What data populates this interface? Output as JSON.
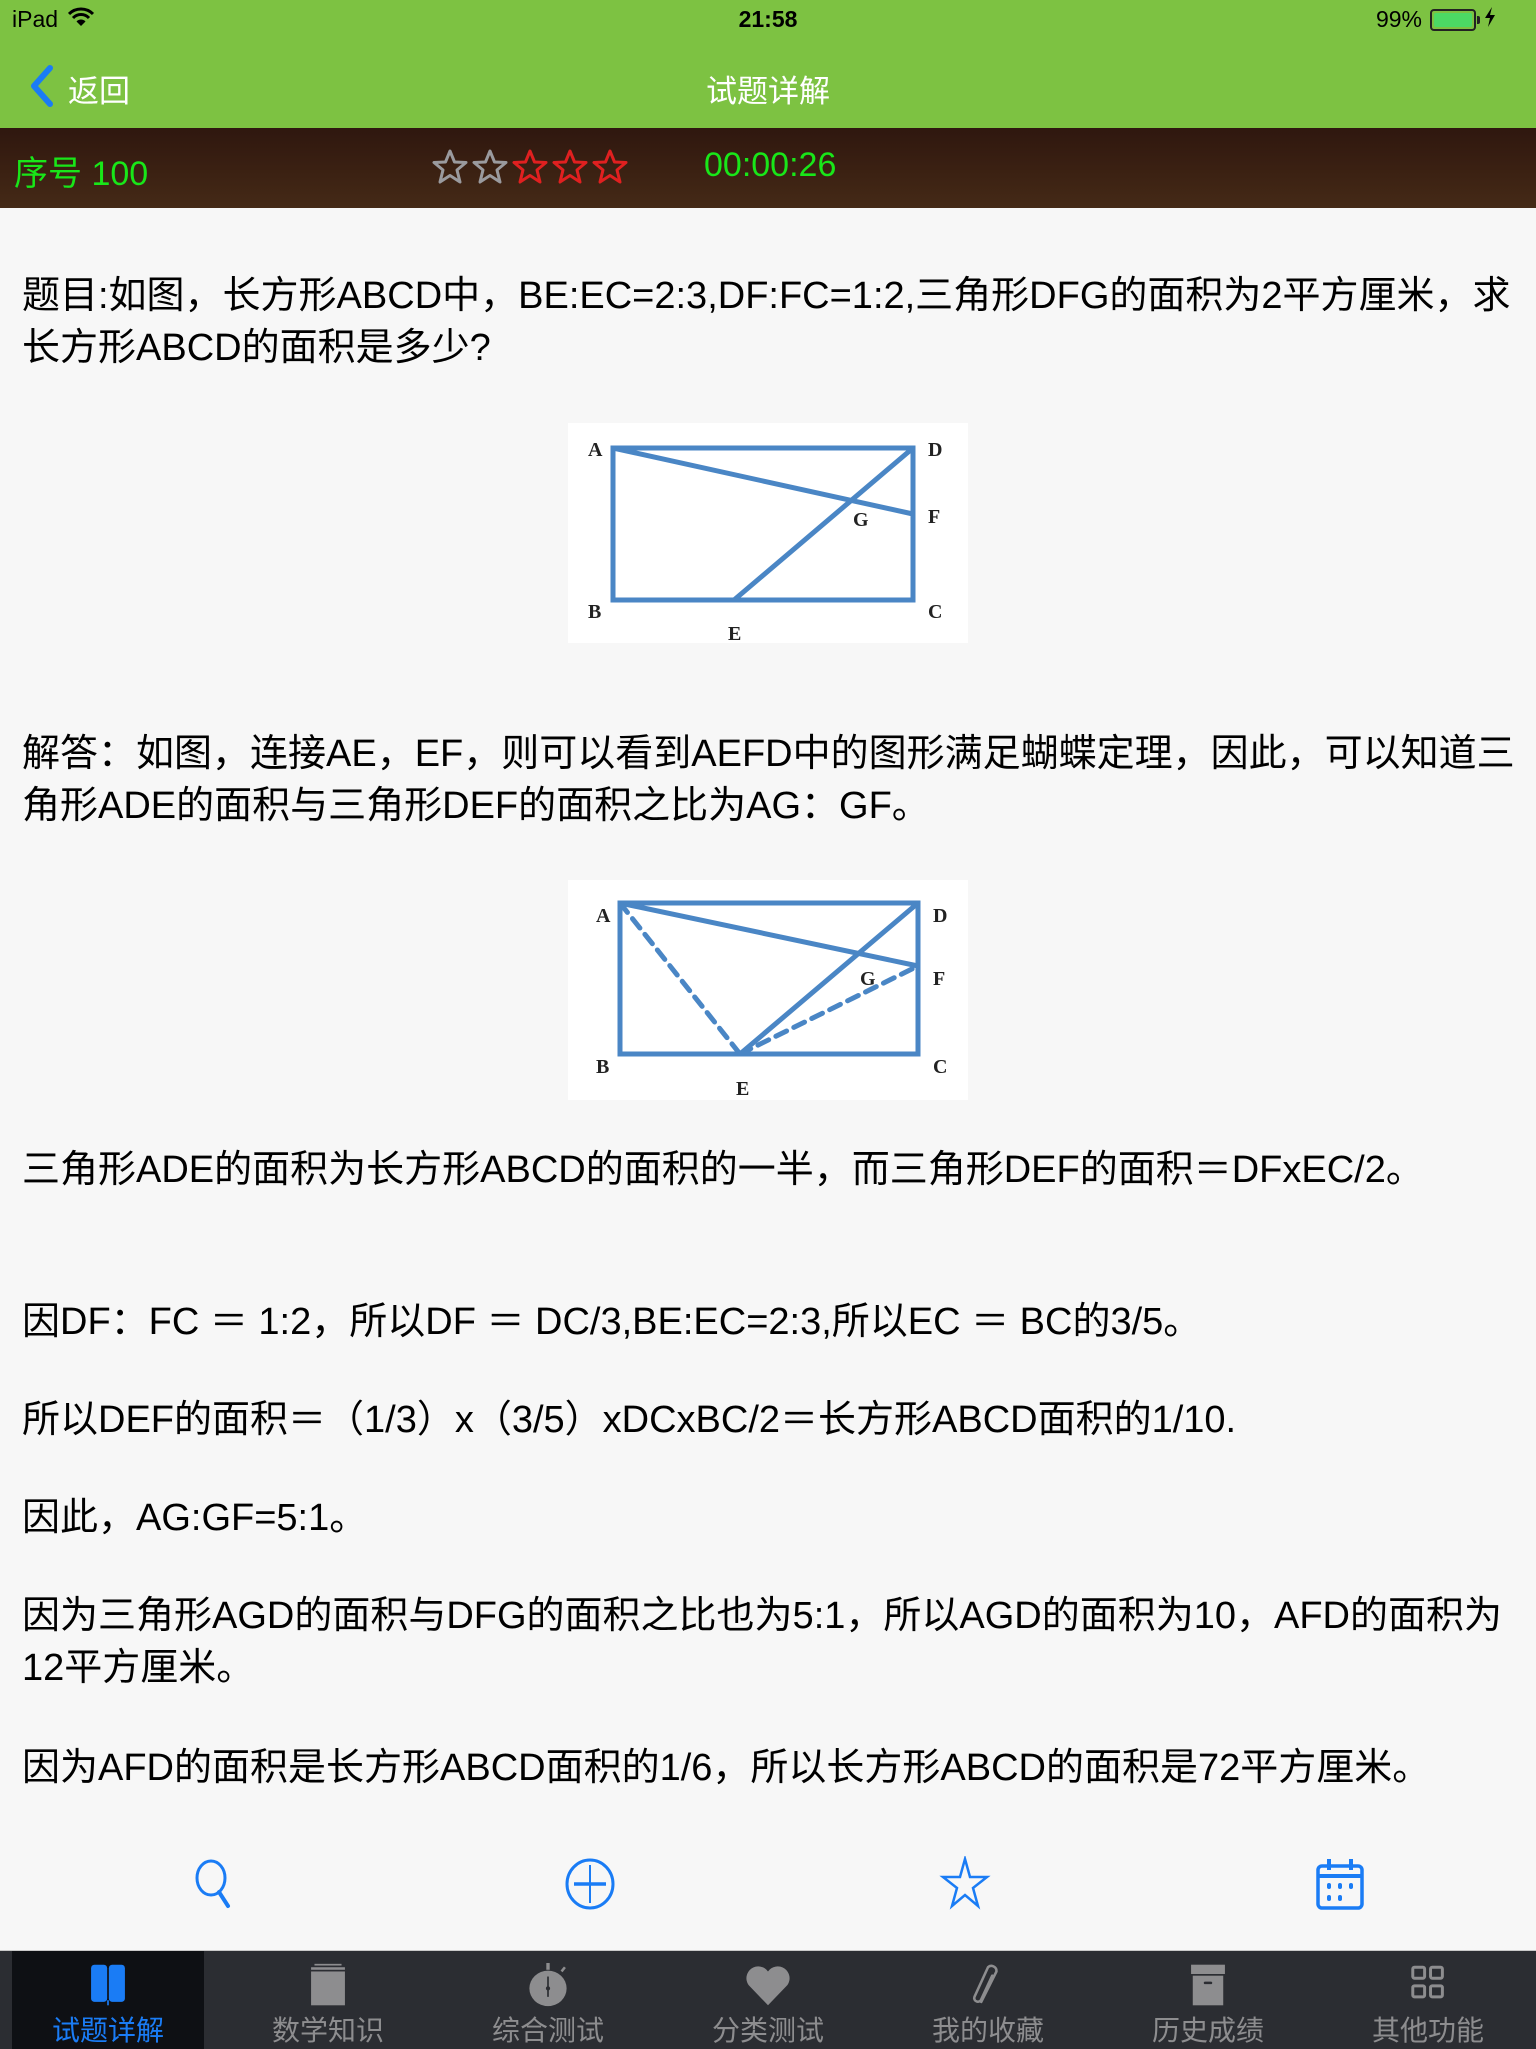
{
  "status_bar": {
    "device": "iPad",
    "time": "21:58",
    "battery_percent": "99%",
    "battery_level": 0.99
  },
  "nav": {
    "back_label": "返回",
    "title": "试题详解"
  },
  "info_bar": {
    "sequence_label": "序号 100",
    "difficulty_stars_total": 5,
    "difficulty_stars_filled": 3,
    "timer": "00:00:26",
    "colors": {
      "text": "#19e619",
      "star_active": "#e02020",
      "star_inactive": "#9a9a9e"
    }
  },
  "content": {
    "question": "题目:如图，长方形ABCD中，BE:EC=2:3,DF:FC=1:2,三角形DFG的面积为2平方厘米，求长方形ABCD的面积是多少?",
    "figure1": {
      "labels": {
        "A": "A",
        "B": "B",
        "C": "C",
        "D": "D",
        "E": "E",
        "F": "F",
        "G": "G"
      },
      "description": "Rectangle ABCD with segments AF and DE intersecting at G"
    },
    "answer_intro": "解答：如图，连接AE，EF，则可以看到AEFD中的图形满足蝴蝶定理，因此，可以知道三角形ADE的面积与三角形DEF的面积之比为AG：GF。",
    "figure2": {
      "labels": {
        "A": "A",
        "B": "B",
        "C": "C",
        "D": "D",
        "E": "E",
        "F": "F",
        "G": "G"
      },
      "description": "Same rectangle with dashed segments AE and EF added"
    },
    "paragraphs": [
      "三角形ADE的面积为长方形ABCD的面积的一半，而三角形DEF的面积＝DFxEC/2。",
      "因DF：FC ＝ 1:2，所以DF ＝ DC/3,BE:EC=2:3,所以EC ＝ BC的3/5。",
      "所以DEF的面积＝（1/3）x（3/5）xDCxBC/2＝长方形ABCD面积的1/10.",
      "因此，AG:GF=5:1。",
      "因为三角形AGD的面积与DFG的面积之比也为5:1，所以AGD的面积为10，AFD的面积为12平方厘米。",
      "因为AFD的面积是长方形ABCD面积的1/6，所以长方形ABCD的面积是72平方厘米。"
    ]
  },
  "toolbar": {
    "icons": [
      "search-icon",
      "add-circle-icon",
      "star-icon",
      "calendar-icon"
    ],
    "color": "#1a7cf5"
  },
  "tab_bar": {
    "selected_index": 0,
    "tabs": [
      {
        "label": "试题详解",
        "icon": "book-icon"
      },
      {
        "label": "数学知识",
        "icon": "stack-icon"
      },
      {
        "label": "综合测试",
        "icon": "stopwatch-icon"
      },
      {
        "label": "分类测试",
        "icon": "heart-icon"
      },
      {
        "label": "我的收藏",
        "icon": "paperclip-icon"
      },
      {
        "label": "历史成绩",
        "icon": "archive-box-icon"
      },
      {
        "label": "其他功能",
        "icon": "grid-icon"
      }
    ],
    "colors": {
      "active": "#1a7cf5",
      "inactive": "#8d8d8f"
    }
  },
  "theme": {
    "header_green": "#7dc242",
    "figure_line": "#4a86c5"
  }
}
